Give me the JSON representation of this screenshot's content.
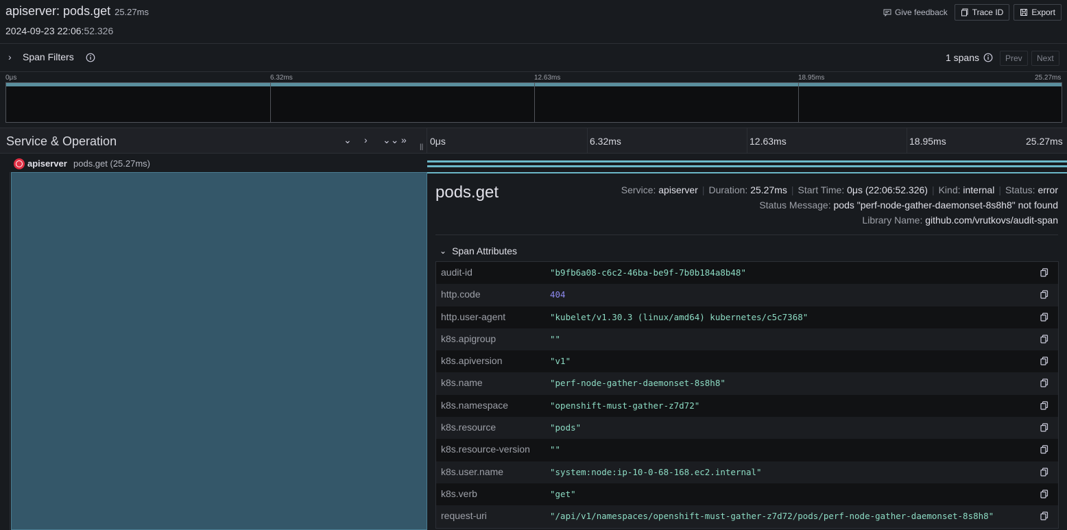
{
  "header": {
    "title": "apiserver: pods.get",
    "duration": "25.27ms",
    "date_main": "2024-09-23 22:06:",
    "date_sub": "52.326",
    "feedback": "Give feedback",
    "trace_id": "Trace ID",
    "export": "Export"
  },
  "filters": {
    "label": "Span Filters",
    "span_count": "1 spans",
    "prev": "Prev",
    "next": "Next"
  },
  "minimap": {
    "ticks": [
      "0μs",
      "6.32ms",
      "12.63ms",
      "18.95ms",
      "25.27ms"
    ]
  },
  "timeline": {
    "title": "Service & Operation",
    "ticks": [
      "0μs",
      "6.32ms",
      "12.63ms",
      "18.95ms",
      "25.27ms"
    ]
  },
  "row": {
    "service": "apiserver",
    "operation": "pods.get (25.27ms)"
  },
  "detail": {
    "title": "pods.get",
    "service_label": "Service:",
    "service": "apiserver",
    "duration_label": "Duration:",
    "duration": "25.27ms",
    "start_label": "Start Time:",
    "start": "0μs (22:06:52.326)",
    "kind_label": "Kind:",
    "kind": "internal",
    "status_label": "Status:",
    "status": "error",
    "status_msg_label": "Status Message:",
    "status_msg": "pods \"perf-node-gather-daemonset-8s8h8\" not found",
    "library_label": "Library Name:",
    "library": "github.com/vrutkovs/audit-span",
    "attributes_title": "Span Attributes",
    "attributes": [
      {
        "key": "audit-id",
        "value": "\"b9fb6a08-c6c2-46ba-be9f-7b0b184a8b48\""
      },
      {
        "key": "http.code",
        "value": "404"
      },
      {
        "key": "http.user-agent",
        "value": "\"kubelet/v1.30.3 (linux/amd64) kubernetes/c5c7368\""
      },
      {
        "key": "k8s.apigroup",
        "value": "\"\""
      },
      {
        "key": "k8s.apiversion",
        "value": "\"v1\""
      },
      {
        "key": "k8s.name",
        "value": "\"perf-node-gather-daemonset-8s8h8\""
      },
      {
        "key": "k8s.namespace",
        "value": "\"openshift-must-gather-z7d72\""
      },
      {
        "key": "k8s.resource",
        "value": "\"pods\""
      },
      {
        "key": "k8s.resource-version",
        "value": "\"\""
      },
      {
        "key": "k8s.user.name",
        "value": "\"system:node:ip-10-0-68-168.ec2.internal\""
      },
      {
        "key": "k8s.verb",
        "value": "\"get\""
      },
      {
        "key": "request-uri",
        "value": "\"/api/v1/namespaces/openshift-must-gather-z7d72/pods/perf-node-gather-daemonset-8s8h8\""
      }
    ]
  },
  "colors": {
    "accent": "#6cb8c9",
    "span_fill": "#345769",
    "error_icon": "#e02f44"
  }
}
